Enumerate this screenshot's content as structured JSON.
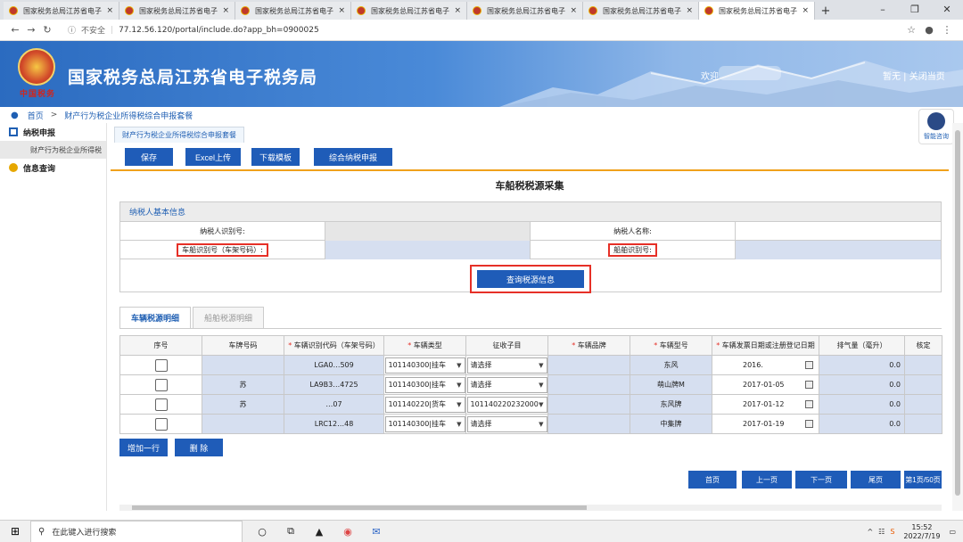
{
  "browser": {
    "tabs": [
      {
        "title": "国家税务总局江苏省电子"
      },
      {
        "title": "国家税务总局江苏省电子"
      },
      {
        "title": "国家税务总局江苏省电子"
      },
      {
        "title": "国家税务总局江苏省电子"
      },
      {
        "title": "国家税务总局江苏省电子"
      },
      {
        "title": "国家税务总局江苏省电子"
      },
      {
        "title": "国家税务总局江苏省电子"
      }
    ],
    "url_security": "不安全",
    "url": "77.12.56.120/portal/include.do?app_bh=0900025"
  },
  "header": {
    "site_title": "国家税务总局江苏省电子税务局",
    "emblem_text": "中国税务",
    "welcome": "欢迎",
    "links": "暂无 | 关闭当页"
  },
  "breadcrumb": {
    "home": "首页",
    "current": "财产行为税企业所得税综合申报套餐"
  },
  "sidebar": {
    "items": [
      {
        "label": "纳税申报"
      },
      {
        "label": "财产行为税企业所得税"
      },
      {
        "label": "信息查询"
      }
    ]
  },
  "smart_help": "智能咨询",
  "page_tab": "财产行为税企业所得税综合申报套餐",
  "toolbar": {
    "save": "保存",
    "excel": "Excel上传",
    "download": "下载模板",
    "comprehensive": "综合纳税申报"
  },
  "form": {
    "title": "车船税税源采集",
    "basic_header": "纳税人基本信息",
    "taxpayer_id_label": "纳税人识别号:",
    "taxpayer_name_label": "纳税人名称:",
    "vehicle_id_label": "车船识别号（车架号码）:",
    "ship_id_label": "船舶识别号:",
    "query_button": "查询税源信息"
  },
  "detail_tabs": {
    "vehicle": "车辆税源明细",
    "ship": "船舶税源明细"
  },
  "table": {
    "columns": [
      "序号",
      "车牌号码",
      "车辆识别代码（车架号码）",
      "车辆类型",
      "征收子目",
      "车辆品牌",
      "车辆型号",
      "车辆发票日期或注册登记日期",
      "排气量（毫升）",
      "核定"
    ],
    "rows": [
      {
        "plate": "",
        "vin": "LGA0…509",
        "type": "101140300|挂车",
        "subitem": "请选择",
        "brand": "",
        "model": "东风",
        "date": "2016.",
        "disp": "0.0"
      },
      {
        "plate": "苏",
        "vin": "LA9B3…4725",
        "type": "101140300|挂车",
        "subitem": "请选择",
        "brand": "",
        "model": "萌山牌M",
        "date": "2017-01-05",
        "disp": "0.0"
      },
      {
        "plate": "苏",
        "vin": "…07",
        "type": "101140220|货车",
        "subitem": "101140220232000",
        "brand": "",
        "model": "东风牌",
        "date": "2017-01-12",
        "disp": "0.0"
      },
      {
        "plate": "",
        "vin": "LRC12…48",
        "type": "101140300|挂车",
        "subitem": "请选择",
        "brand": "",
        "model": "中集牌",
        "date": "2017-01-19",
        "disp": "0.0"
      }
    ]
  },
  "row_buttons": {
    "add": "增加一行",
    "delete": "删 除"
  },
  "pager": {
    "first": "首页",
    "prev": "上一页",
    "next": "下一页",
    "last": "尾页",
    "info": "第1页/50页"
  },
  "taskbar": {
    "search": "在此键入进行搜索",
    "time": "15:52",
    "date": "2022/7/19"
  }
}
